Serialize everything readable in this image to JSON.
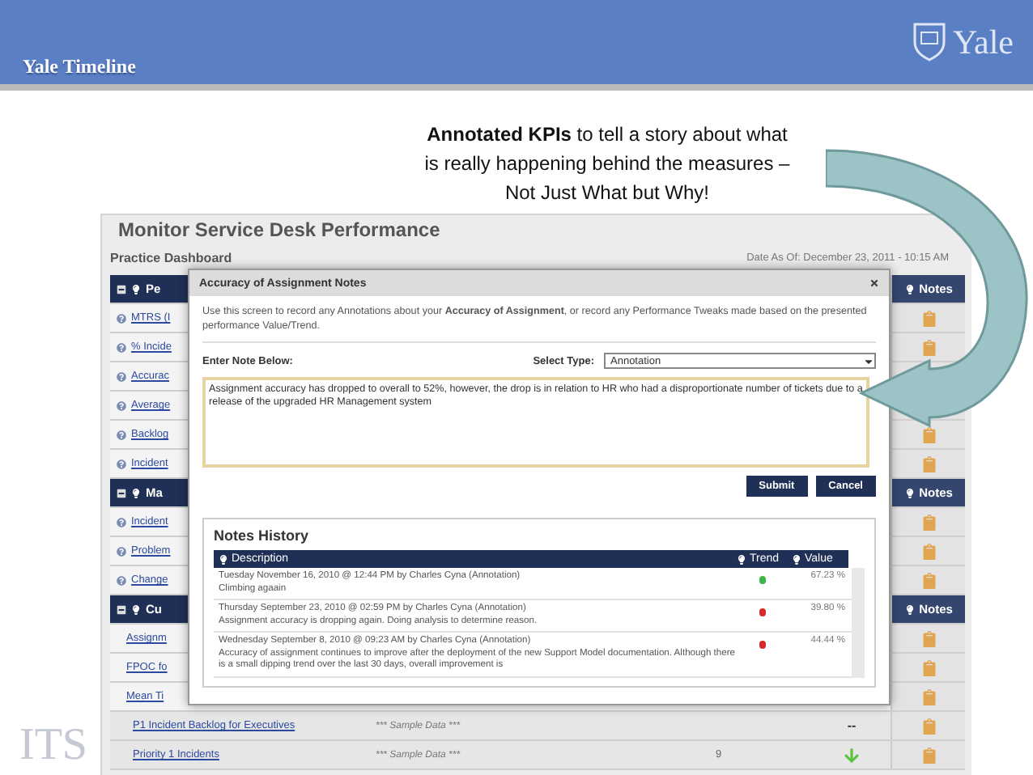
{
  "header": {
    "title": "Yale Timeline",
    "logo_text": "Yale"
  },
  "caption": "**Annotated KPIs** to tell a story about what is really happening behind the measures – Not Just What but Why!",
  "footer_mark": "ITS",
  "dashboard": {
    "title": "Monitor Service Desk Performance",
    "subtitle": "Practice Dashboard",
    "date": "Date As Of: December 23, 2011 - 10:15 AM",
    "sections": [
      {
        "label": "Pe",
        "notes_label": "Notes",
        "rows": [
          {
            "label": "MTRS (I",
            "help": true
          },
          {
            "label": "% Incide",
            "help": true
          },
          {
            "label": "Accurac",
            "help": true
          },
          {
            "label": "Average",
            "help": true
          },
          {
            "label": "Backlog",
            "help": true
          },
          {
            "label": "Incident",
            "help": true
          }
        ]
      },
      {
        "label": "Ma",
        "notes_label": "Notes",
        "rows": [
          {
            "label": "Incident",
            "help": true
          },
          {
            "label": "Problem",
            "help": true
          },
          {
            "label": "Change",
            "help": true
          }
        ]
      },
      {
        "label": "Cu",
        "notes_label": "Notes",
        "rows": [
          {
            "label": "Assignm",
            "help": false
          },
          {
            "label": "FPOC fo",
            "help": false
          },
          {
            "label": "Mean Ti",
            "help": false
          }
        ]
      }
    ],
    "full_rows": [
      {
        "label": "P1 Incident Backlog for Executives",
        "note": "*** Sample Data ***",
        "trend": {
          "kind": "text",
          "text": "--"
        }
      },
      {
        "label": "Priority 1 Incidents",
        "note": "*** Sample Data ***",
        "value": "9",
        "trend": {
          "kind": "down-arrow"
        }
      }
    ]
  },
  "modal": {
    "title": "Accuracy of Assignment Notes",
    "description": "Use this screen to record any Annotations about your **Accuracy of Assignment**, or record any Performance Tweaks made based on the presented performance Value/Trend.",
    "note_label": "Enter Note Below:",
    "type_label": "Select Type:",
    "type_value": "Annotation",
    "note_value": "Assignment accuracy has dropped to overall to 52%, however, the drop is in relation to HR who had a disproportionate number of tickets due to a release of the upgraded HR Management system",
    "buttons": [
      "Submit",
      "Cancel"
    ],
    "history": {
      "title": "Notes History",
      "columns": [
        "Description",
        "Trend",
        "Value"
      ],
      "rows": [
        {
          "meta": "Tuesday November 16, 2010 @ 12:44 PM by Charles Cyna (Annotation)",
          "text": "Climbing agaain",
          "color": "#3bb84a",
          "value": "67.23 %"
        },
        {
          "meta": "Thursday September 23, 2010 @ 02:59 PM by Charles Cyna (Annotation)",
          "text": "Assignment accuracy is dropping again. Doing analysis to determine reason.",
          "color": "#d42a2a",
          "value": "39.80 %"
        },
        {
          "meta": "Wednesday September 8, 2010 @ 09:23 AM by Charles Cyna (Annotation)",
          "text": "Accuracy of assignment continues to improve after the deployment of the new Support Model documentation. Although there is a small dipping trend over the last 30 days, overall improvement is",
          "color": "#d42a2a",
          "value": "44.44 %"
        }
      ]
    }
  }
}
